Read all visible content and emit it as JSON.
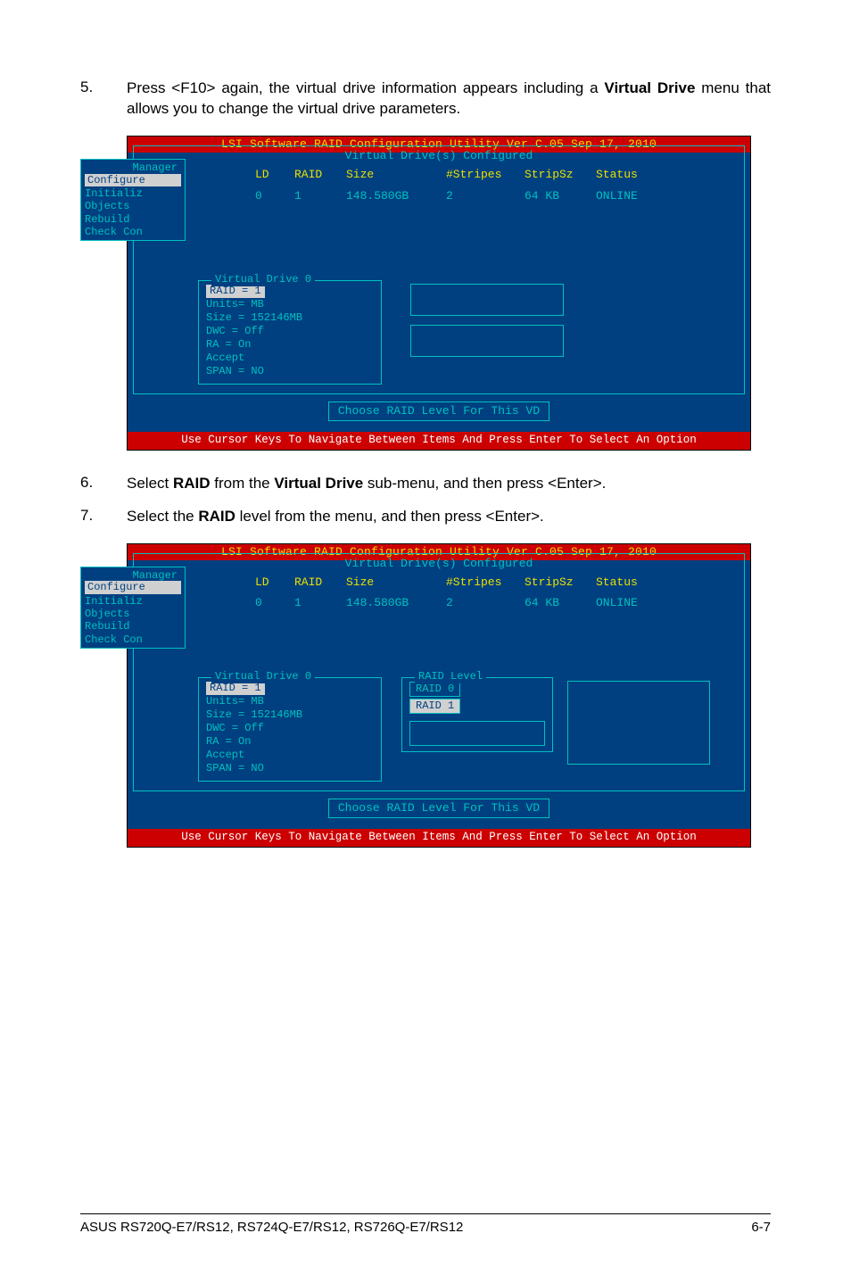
{
  "steps": {
    "s5": {
      "num": "5.",
      "text_a": "Press <F10> again, the virtual drive information appears including a ",
      "text_b": "Virtual Drive",
      "text_c": " menu that allows you to change the virtual drive parameters."
    },
    "s6": {
      "num": "6.",
      "text_a": "Select ",
      "text_b": "RAID",
      "text_c": " from the ",
      "text_d": "Virtual Drive",
      "text_e": " sub-menu, and then press <Enter>."
    },
    "s7": {
      "num": "7.",
      "text_a": "Select the ",
      "text_b": "RAID",
      "text_c": " level from the menu, and then press <Enter>."
    }
  },
  "bios": {
    "title": "LSI Software RAID Configuration Utility Ver C.05 Sep 17, 2010",
    "subtitle": "Virtual Drive(s) Configured",
    "head": {
      "c0": "LD",
      "c1": "RAID",
      "c2": "Size",
      "c3": "#Stripes",
      "c4": "StripSz",
      "c5": "Status"
    },
    "row": {
      "c0": "0",
      "c1": "1",
      "c2": "148.580GB",
      "c3": "2",
      "c4": "64 KB",
      "c5": "ONLINE"
    },
    "left_menu": {
      "top": "Manager",
      "items": [
        "Configure",
        "Initializ",
        "Objects",
        "Rebuild",
        "Check Con"
      ]
    },
    "mini_frame": {
      "title": "Virtual Drive 0",
      "items": [
        "RAID = 1",
        "Units= MB",
        "Size = 152146MB",
        "DWC  = Off",
        "RA   = On",
        "Accept",
        "SPAN = NO"
      ]
    },
    "raid_level": {
      "title": "RAID Level",
      "items": [
        "RAID 0",
        "RAID 1"
      ]
    },
    "prompt": "Choose RAID Level For This VD",
    "footer": "Use Cursor Keys To Navigate Between Items And Press Enter To Select An Option"
  },
  "page_footer": {
    "left": "ASUS RS720Q-E7/RS12, RS724Q-E7/RS12, RS726Q-E7/RS12",
    "right": "6-7"
  }
}
